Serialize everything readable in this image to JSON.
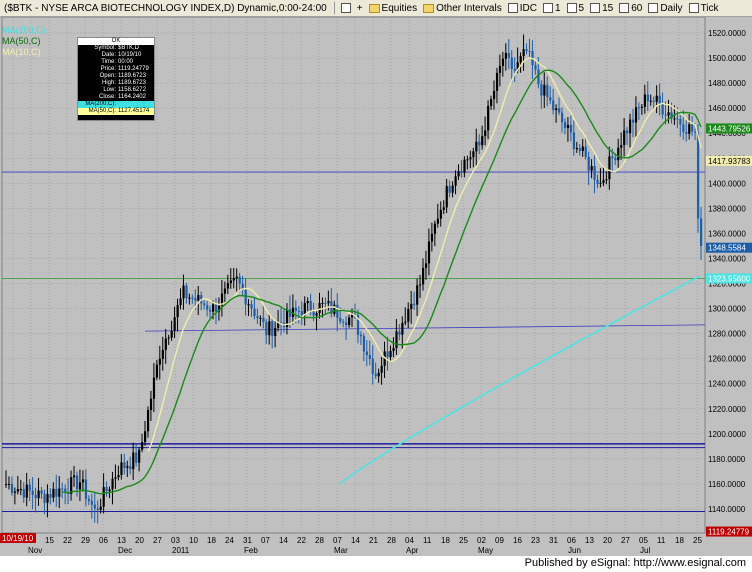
{
  "titlebar": {
    "symbol_title": "($BTK - NYSE ARCA BIOTECHNOLOGY INDEX,D) Dynamic,0:00-24:00",
    "equities": "Equities",
    "other_intervals": "Other Intervals",
    "idc": "IDC",
    "i1": "1",
    "i5": "5",
    "i15": "15",
    "i60": "60",
    "daily": "Daily",
    "tick": "Tick"
  },
  "legend": {
    "ma200": "MA(200,C)",
    "ma50": "MA(50,C)",
    "ma10": "MA(10,C)"
  },
  "datawindow": {
    "header": "OK",
    "rows": [
      {
        "k": "Symbol:",
        "v": "$BTK,D"
      },
      {
        "k": "Date:",
        "v": "10/19/10"
      },
      {
        "k": "Time:",
        "v": "00:00"
      },
      {
        "k": "Price:",
        "v": "1119.24779"
      },
      {
        "k": "Open:",
        "v": "1189.6723"
      },
      {
        "k": "High:",
        "v": "1189.6723"
      },
      {
        "k": "Low:",
        "v": "1158.6272"
      },
      {
        "k": "Close:",
        "v": "1164.2402"
      }
    ],
    "ma200_row": "MA(200,C):",
    "ma50_row": "MA(50,C):",
    "ma50_val": "1127.45174"
  },
  "price_axis": {
    "ticks": [
      "1520.0000",
      "1500.0000",
      "1480.0000",
      "1460.0000",
      "1440.0000",
      "1420.0000",
      "1400.0000",
      "1380.0000",
      "1360.0000",
      "1340.0000",
      "1320.0000",
      "1300.0000",
      "1280.0000",
      "1260.0000",
      "1240.0000",
      "1220.0000",
      "1200.0000",
      "1180.0000",
      "1160.0000",
      "1140.0000"
    ],
    "flag_ma50": "1443.79526",
    "flag_ma10": "1417.93783",
    "flag_price": "1348.5584",
    "flag_ma200": "1323.95600",
    "flag_bottom": "1119.24779"
  },
  "time_axis": {
    "date_flag": "10/19/10",
    "day_labels": [
      "01",
      "08",
      "15",
      "22",
      "29",
      "06",
      "13",
      "20",
      "27",
      "03",
      "10",
      "18",
      "24",
      "31",
      "07",
      "14",
      "22",
      "28",
      "07",
      "14",
      "21",
      "28",
      "04",
      "11",
      "18",
      "25",
      "02",
      "09",
      "16",
      "23",
      "31",
      "06",
      "13",
      "20",
      "27",
      "05",
      "11",
      "18",
      "25"
    ],
    "month_labels": [
      "Nov",
      "Dec",
      "2011",
      "Feb",
      "Mar",
      "Apr",
      "May",
      "Jun",
      "Jul"
    ]
  },
  "colors": {
    "background": "#c0c0c0",
    "up_bar": "#000000",
    "down_bar": "#1d5ea8",
    "ma10": "#f0ecb0",
    "ma50": "#1a8a1a",
    "ma200": "#4de3e3",
    "hline_blue": "#1c1c9e",
    "hline_green": "#2a9a2a",
    "grid": "#8a8a8a"
  },
  "footer": {
    "publisher": "Published by eSignal: http://www.esignal.com"
  }
}
